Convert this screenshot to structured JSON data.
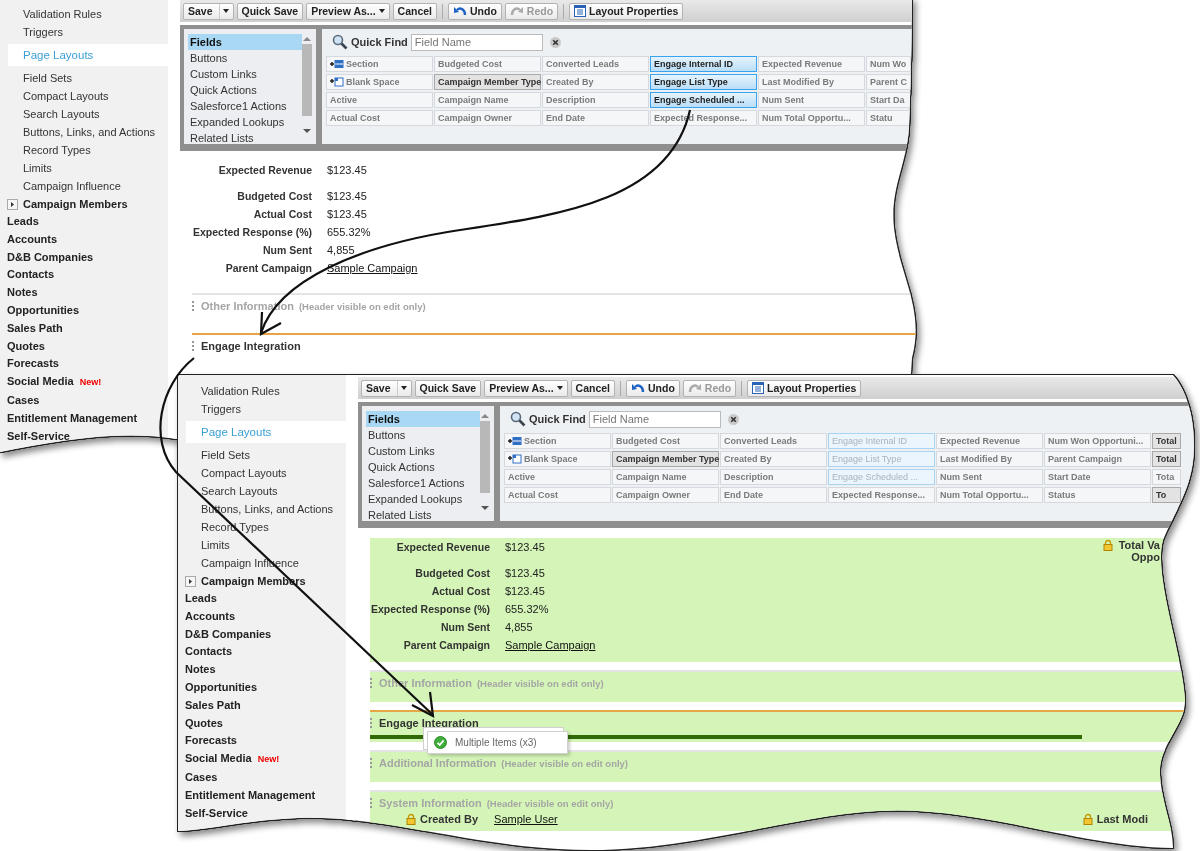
{
  "panels": [
    {
      "sidebar": {
        "sub_items": [
          {
            "label": "Validation Rules",
            "selected": false
          },
          {
            "label": "Triggers",
            "selected": false
          },
          {
            "label": "Page Layouts",
            "selected": true
          },
          {
            "label": "Field Sets",
            "selected": false
          },
          {
            "label": "Compact Layouts",
            "selected": false
          },
          {
            "label": "Search Layouts",
            "selected": false
          },
          {
            "label": "Buttons, Links, and Actions",
            "selected": false
          },
          {
            "label": "Record Types",
            "selected": false
          },
          {
            "label": "Limits",
            "selected": false
          },
          {
            "label": "Campaign Influence",
            "selected": false
          }
        ],
        "parent": {
          "label": "Campaign Members",
          "expanded": false
        },
        "objects": [
          {
            "label": "Leads"
          },
          {
            "label": "Accounts"
          },
          {
            "label": "D&B Companies"
          },
          {
            "label": "Contacts"
          },
          {
            "label": "Notes"
          },
          {
            "label": "Opportunities"
          },
          {
            "label": "Sales Path"
          },
          {
            "label": "Quotes"
          },
          {
            "label": "Forecasts"
          },
          {
            "label": "Social Media",
            "badge": "New!"
          },
          {
            "label": "Cases"
          },
          {
            "label": "Entitlement Management"
          },
          {
            "label": "Self-Service"
          }
        ]
      },
      "toolbar": [
        {
          "label": "Save",
          "kind": "split",
          "disabled": false
        },
        {
          "label": "Quick Save",
          "kind": "plain",
          "disabled": false
        },
        {
          "label": "Preview As...",
          "kind": "menu",
          "disabled": false
        },
        {
          "label": "Cancel",
          "kind": "plain",
          "disabled": false
        },
        {
          "label": "Undo",
          "kind": "undo",
          "disabled": false
        },
        {
          "label": "Redo",
          "kind": "redo",
          "disabled": true
        },
        {
          "label": "Layout Properties",
          "kind": "properties",
          "disabled": false
        }
      ],
      "categories": [
        {
          "label": "Fields",
          "selected": true
        },
        {
          "label": "Buttons",
          "selected": false
        },
        {
          "label": "Custom Links",
          "selected": false
        },
        {
          "label": "Quick Actions",
          "selected": false
        },
        {
          "label": "Salesforce1 Actions",
          "selected": false
        },
        {
          "label": "Expanded Lookups",
          "selected": false
        },
        {
          "label": "Related Lists",
          "selected": false
        }
      ],
      "quick_find": {
        "label": "Quick Find",
        "placeholder": "Field Name"
      },
      "field_rows": [
        [
          {
            "label": "Section",
            "kind": "section"
          },
          {
            "label": "Budgeted Cost",
            "kind": "normal"
          },
          {
            "label": "Converted Leads",
            "kind": "normal"
          },
          {
            "label": "Engage Internal ID",
            "kind": "selected"
          },
          {
            "label": "Expected Revenue",
            "kind": "normal"
          },
          {
            "label": "Num Wo",
            "kind": "normal"
          }
        ],
        [
          {
            "label": "Blank Space",
            "kind": "blank_space"
          },
          {
            "label": "Campaign Member Type",
            "kind": "used"
          },
          {
            "label": "Created By",
            "kind": "normal"
          },
          {
            "label": "Engage List Type",
            "kind": "selected"
          },
          {
            "label": "Last Modified By",
            "kind": "normal"
          },
          {
            "label": "Parent C",
            "kind": "normal"
          }
        ],
        [
          {
            "label": "Active",
            "kind": "normal"
          },
          {
            "label": "Campaign Name",
            "kind": "normal"
          },
          {
            "label": "Description",
            "kind": "normal"
          },
          {
            "label": "Engage Scheduled ...",
            "kind": "selected"
          },
          {
            "label": "Num Sent",
            "kind": "normal"
          },
          {
            "label": "Start Da",
            "kind": "normal"
          }
        ],
        [
          {
            "label": "Actual Cost",
            "kind": "normal"
          },
          {
            "label": "Campaign Owner",
            "kind": "normal"
          },
          {
            "label": "End Date",
            "kind": "normal"
          },
          {
            "label": "Expected Response...",
            "kind": "normal"
          },
          {
            "label": "Num Total Opportu...",
            "kind": "normal"
          },
          {
            "label": "Statu",
            "kind": "normal"
          }
        ]
      ],
      "detail_rows": [
        {
          "label": "Expected Revenue",
          "value": "$123.45",
          "link": false
        },
        {
          "label": "Budgeted Cost",
          "value": "$123.45",
          "link": false
        },
        {
          "label": "Actual Cost",
          "value": "$123.45",
          "link": false
        },
        {
          "label": "Expected Response (%)",
          "value": "655.32%",
          "link": false
        },
        {
          "label": "Num Sent",
          "value": "4,855",
          "link": false
        },
        {
          "label": "Parent Campaign",
          "value": "Sample Campaign",
          "link": true
        }
      ],
      "sections": [
        {
          "title": "Other Information",
          "note": "(Header visible on edit only)",
          "header_hidden": true,
          "drop_target": false
        },
        {
          "title": "Engage Integration",
          "header_hidden": false,
          "drop_target": true
        }
      ]
    },
    {
      "sidebar": {
        "sub_items": [
          {
            "label": "Validation Rules",
            "selected": false
          },
          {
            "label": "Triggers",
            "selected": false
          },
          {
            "label": "Page Layouts",
            "selected": true
          },
          {
            "label": "Field Sets",
            "selected": false
          },
          {
            "label": "Compact Layouts",
            "selected": false
          },
          {
            "label": "Search Layouts",
            "selected": false
          },
          {
            "label": "Buttons, Links, and Actions",
            "selected": false
          },
          {
            "label": "Record Types",
            "selected": false
          },
          {
            "label": "Limits",
            "selected": false
          },
          {
            "label": "Campaign Influence",
            "selected": false
          }
        ],
        "parent": {
          "label": "Campaign Members",
          "expanded": false
        },
        "objects": [
          {
            "label": "Leads"
          },
          {
            "label": "Accounts"
          },
          {
            "label": "D&B Companies"
          },
          {
            "label": "Contacts"
          },
          {
            "label": "Notes"
          },
          {
            "label": "Opportunities"
          },
          {
            "label": "Sales Path"
          },
          {
            "label": "Quotes"
          },
          {
            "label": "Forecasts"
          },
          {
            "label": "Social Media",
            "badge": "New!"
          },
          {
            "label": "Cases"
          },
          {
            "label": "Entitlement Management"
          },
          {
            "label": "Self-Service"
          }
        ]
      },
      "toolbar": [
        {
          "label": "Save",
          "kind": "split",
          "disabled": false
        },
        {
          "label": "Quick Save",
          "kind": "plain",
          "disabled": false
        },
        {
          "label": "Preview As...",
          "kind": "menu",
          "disabled": false
        },
        {
          "label": "Cancel",
          "kind": "plain",
          "disabled": false
        },
        {
          "label": "Undo",
          "kind": "undo",
          "disabled": false
        },
        {
          "label": "Redo",
          "kind": "redo",
          "disabled": true
        },
        {
          "label": "Layout Properties",
          "kind": "properties",
          "disabled": false
        }
      ],
      "categories": [
        {
          "label": "Fields",
          "selected": true
        },
        {
          "label": "Buttons",
          "selected": false
        },
        {
          "label": "Custom Links",
          "selected": false
        },
        {
          "label": "Quick Actions",
          "selected": false
        },
        {
          "label": "Salesforce1 Actions",
          "selected": false
        },
        {
          "label": "Expanded Lookups",
          "selected": false
        },
        {
          "label": "Related Lists",
          "selected": false
        }
      ],
      "quick_find": {
        "label": "Quick Find",
        "placeholder": "Field Name"
      },
      "field_rows": [
        [
          {
            "label": "Section",
            "kind": "section"
          },
          {
            "label": "Budgeted Cost",
            "kind": "normal"
          },
          {
            "label": "Converted Leads",
            "kind": "normal"
          },
          {
            "label": "Engage Internal ID",
            "kind": "placed"
          },
          {
            "label": "Expected Revenue",
            "kind": "normal"
          },
          {
            "label": "Num Won Opportuni...",
            "kind": "normal"
          },
          {
            "label": "Total",
            "kind": "used"
          }
        ],
        [
          {
            "label": "Blank Space",
            "kind": "blank_space"
          },
          {
            "label": "Campaign Member Type",
            "kind": "used"
          },
          {
            "label": "Created By",
            "kind": "normal"
          },
          {
            "label": "Engage List Type",
            "kind": "placed"
          },
          {
            "label": "Last Modified By",
            "kind": "normal"
          },
          {
            "label": "Parent Campaign",
            "kind": "normal"
          },
          {
            "label": "Total",
            "kind": "used"
          }
        ],
        [
          {
            "label": "Active",
            "kind": "normal"
          },
          {
            "label": "Campaign Name",
            "kind": "normal"
          },
          {
            "label": "Description",
            "kind": "normal"
          },
          {
            "label": "Engage Scheduled ...",
            "kind": "placed"
          },
          {
            "label": "Num Sent",
            "kind": "normal"
          },
          {
            "label": "Start Date",
            "kind": "normal"
          },
          {
            "label": "Tota",
            "kind": "normal"
          }
        ],
        [
          {
            "label": "Actual Cost",
            "kind": "normal"
          },
          {
            "label": "Campaign Owner",
            "kind": "normal"
          },
          {
            "label": "End Date",
            "kind": "normal"
          },
          {
            "label": "Expected Response...",
            "kind": "normal"
          },
          {
            "label": "Num Total Opportu...",
            "kind": "normal"
          },
          {
            "label": "Status",
            "kind": "normal"
          },
          {
            "label": "To",
            "kind": "used"
          }
        ]
      ],
      "detail_rows": [
        {
          "label": "Expected Revenue",
          "value": "$123.45",
          "link": false
        },
        {
          "label": "Budgeted Cost",
          "value": "$123.45",
          "link": false
        },
        {
          "label": "Actual Cost",
          "value": "$123.45",
          "link": false
        },
        {
          "label": "Expected Response (%)",
          "value": "655.32%",
          "link": false
        },
        {
          "label": "Num Sent",
          "value": "4,855",
          "link": false
        },
        {
          "label": "Parent Campaign",
          "value": "Sample Campaign",
          "link": true
        }
      ],
      "side_field": {
        "lines": [
          "Total Va",
          "Oppo"
        ],
        "locked": true
      },
      "sections": [
        {
          "title": "Other Information",
          "note": "(Header visible on edit only)",
          "header_hidden": true,
          "drop_target": false
        },
        {
          "title": "Engage Integration",
          "header_hidden": false,
          "drop_target": true
        },
        {
          "title": "Additional Information",
          "note": "(Header visible on edit only)",
          "header_hidden": true,
          "drop_target": false
        },
        {
          "title": "System Information",
          "note": "(Header visible on edit only)",
          "header_hidden": true,
          "drop_target": false,
          "rows": [
            {
              "label": "Created By",
              "value": "Sample User",
              "locked": true,
              "link": true
            },
            {
              "label": "Last Modi",
              "locked": true
            }
          ]
        }
      ],
      "drag_tooltip": {
        "label": "Multiple Items (x3)"
      }
    }
  ]
}
